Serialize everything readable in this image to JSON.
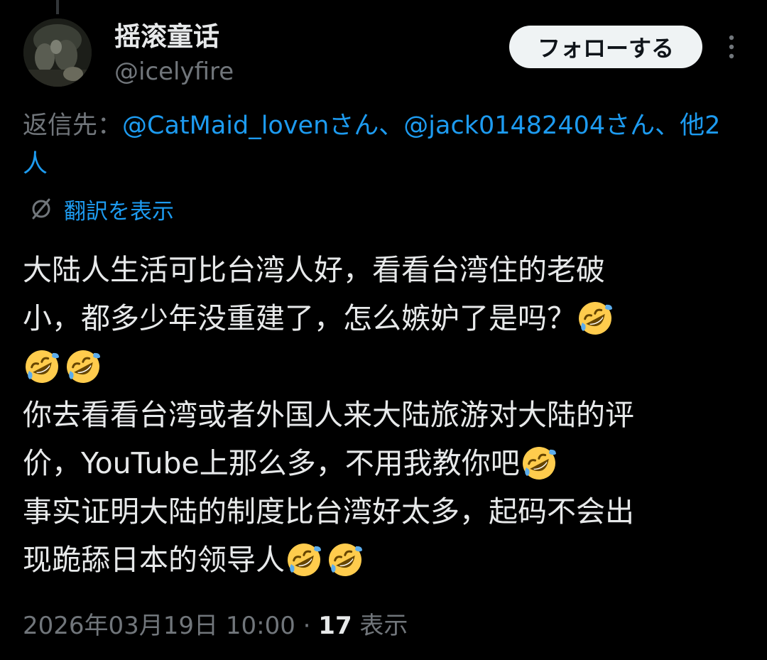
{
  "author": {
    "display_name": "摇滚童话",
    "handle": "@icelyfire"
  },
  "header": {
    "follow_label": "フォローする",
    "more_icon": "more-vertical-icon"
  },
  "reply": {
    "prefix": "返信先：",
    "mention1": "@CatMaid_lovenさん",
    "separator1": "、",
    "mention2": "@jack01482404さん",
    "separator2": "、",
    "others_part1": "他2",
    "others_part2": "人"
  },
  "translate": {
    "icon": "translate-globe-icon",
    "label": "翻訳を表示"
  },
  "tweet": {
    "lines": [
      "大陆人生活可比台湾人好，看看台湾住的老破",
      "小，都多少年没重建了，怎么嫉妒了是吗？",
      "",
      "你去看看台湾或者外国人来大陆旅游对大陆的评",
      "价，YouTube上那么多，不用我教你吧",
      "事实证明大陆的制度比台湾好太多，起码不会出",
      "现跪舔日本的领导人"
    ],
    "emoji_name": "rolling-on-the-floor-laughing-emoji"
  },
  "meta": {
    "timestamp": "2026年03月19日 10:00",
    "dot": " · ",
    "views_count": "17",
    "views_label": " 表示"
  },
  "colors": {
    "background": "#000000",
    "text_primary": "#e7e9ea",
    "text_secondary": "#71767b",
    "link": "#1d9bf0",
    "follow_button_bg": "#eff3f4"
  }
}
